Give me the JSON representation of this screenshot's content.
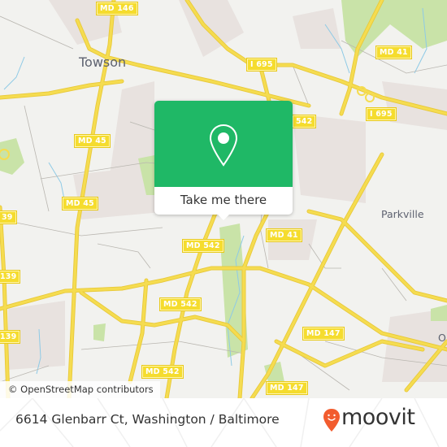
{
  "map": {
    "colors": {
      "background": "#f2f2ef",
      "road": "#f5dc50",
      "road_casing": "#e8c93a",
      "park": "#c9e3a8",
      "urban": "#e8e2df",
      "water": "#8ecae6",
      "minor_road": "#b9b6b0"
    },
    "places": [
      {
        "name": "Towson",
        "kind": "city"
      },
      {
        "name": "Parkville",
        "kind": "town"
      },
      {
        "name": "O",
        "kind": "town"
      }
    ],
    "route_shields": [
      {
        "label": "MD 146"
      },
      {
        "label": "I 695"
      },
      {
        "label": "MD 41"
      },
      {
        "label": "I 695"
      },
      {
        "label": "MD 45"
      },
      {
        "label": "542"
      },
      {
        "label": "MD 45"
      },
      {
        "label": "39"
      },
      {
        "label": "MD 542"
      },
      {
        "label": "MD 41"
      },
      {
        "label": "139"
      },
      {
        "label": "MD 542"
      },
      {
        "label": "139"
      },
      {
        "label": "MD 147"
      },
      {
        "label": "MD 542"
      },
      {
        "label": "MD 147"
      }
    ]
  },
  "popup": {
    "icon": "map-pin-icon",
    "button_label": "Take me there",
    "accent_color": "#1fb866"
  },
  "attribution": "© OpenStreetMap contributors",
  "footer": {
    "address": "6614 Glenbarr Ct, Washington / Baltimore",
    "brand": "moovit",
    "brand_icon": "moovit-smiley-pin-icon",
    "brand_color": "#f25c2e"
  }
}
